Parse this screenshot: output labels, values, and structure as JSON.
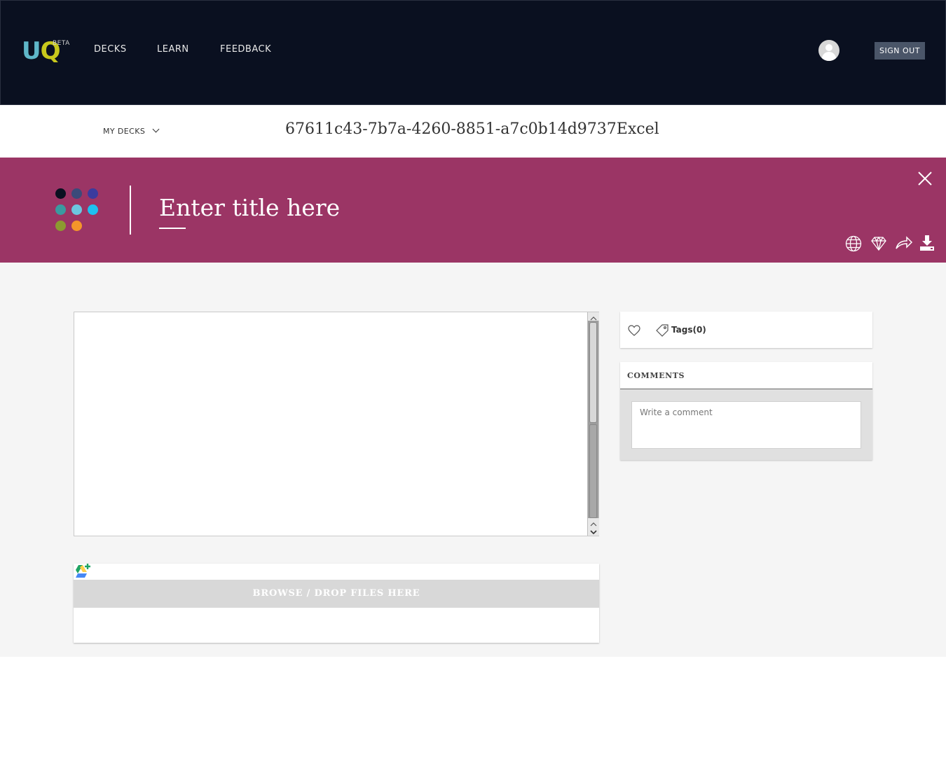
{
  "nav": {
    "logo_u": "U",
    "logo_q": "Q",
    "logo_beta": "BETA",
    "links": [
      "DECKS",
      "LEARN",
      "FEEDBACK"
    ],
    "signout": "SIGN OUT"
  },
  "subheader": {
    "mydecks": "MY DECKS",
    "doc_id": "67611c43-7b7a-4260-8851-a7c0b14d9737Excel"
  },
  "banner": {
    "title_placeholder": "Enter title here",
    "dot_colors": [
      "#0a1020",
      "#3b4a7a",
      "#3b3b9e",
      "#3a9aa0",
      "#6cc6e0",
      "#1ec0f0",
      "#8c9a30",
      "#f5962a"
    ],
    "icons": [
      "globe-icon",
      "diamond-icon",
      "share-icon",
      "download-icon"
    ]
  },
  "uploader": {
    "browse_label": "BROWSE / DROP FILES HERE"
  },
  "sidebar": {
    "tags_label": "Tags(0)",
    "comments_title": "COMMENTS",
    "comment_placeholder": "Write a comment"
  },
  "colors": {
    "nav_bg": "#0a1020",
    "banner_bg": "#9b3565",
    "main_bg": "#f5f5f5"
  }
}
